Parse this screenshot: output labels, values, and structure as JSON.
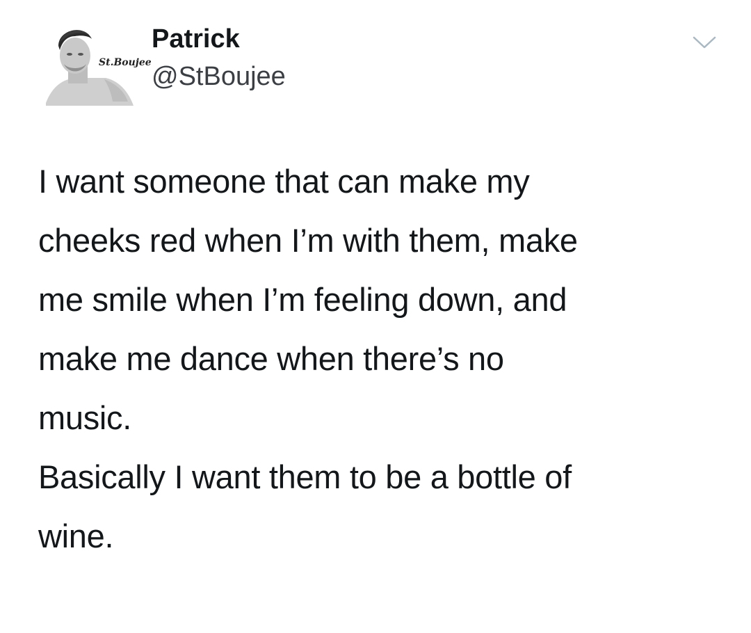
{
  "user": {
    "display_name": "Patrick",
    "handle": "@StBoujee",
    "avatar_watermark": "St.Boujee"
  },
  "tweet": {
    "paragraphs": [
      "I want someone that can make my\ncheeks red when I’m with them, make\nme smile when I’m feeling down, and\nmake me dance when there’s no\nmusic.",
      "Basically I want them to be a bottle of\nwine."
    ]
  },
  "icons": {
    "menu": "chevron-down-icon"
  },
  "colors": {
    "text": "#14171a",
    "secondary_text": "#3b3f44",
    "icon": "#aab8c2",
    "background": "#ffffff"
  }
}
